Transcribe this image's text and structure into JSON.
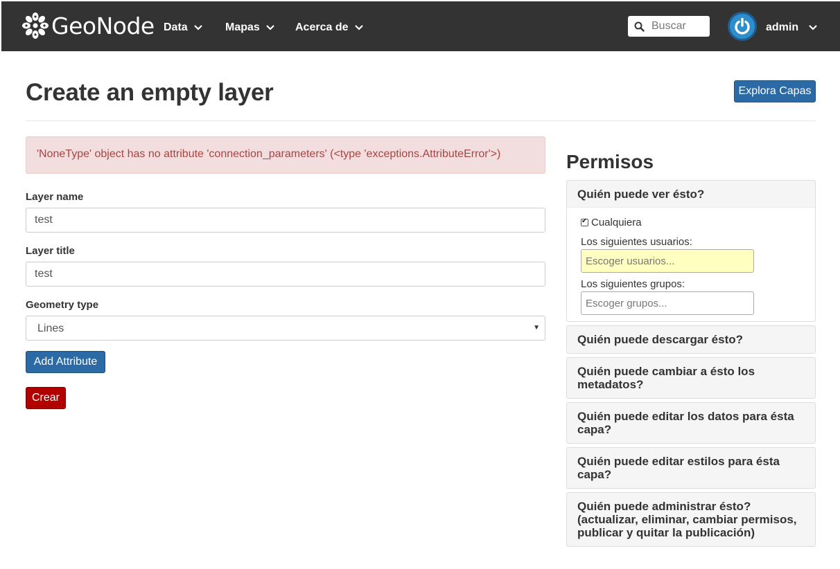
{
  "nav": {
    "brand": "GeoNode",
    "menu": [
      {
        "label": "Data"
      },
      {
        "label": "Mapas"
      },
      {
        "label": "Acerca de"
      }
    ],
    "search_placeholder": "Buscar",
    "user": "admin"
  },
  "page": {
    "title": "Create an empty layer",
    "explore_button": "Explora Capas"
  },
  "alert": {
    "message": "'NoneType' object has no attribute 'connection_parameters' (<type 'exceptions.AttributeError'>)"
  },
  "form": {
    "layer_name_label": "Layer name",
    "layer_name_value": "test",
    "layer_title_label": "Layer title",
    "layer_title_value": "test",
    "geometry_label": "Geometry type",
    "geometry_value": "Lines",
    "add_attribute": "Add Attribute",
    "create": "Crear"
  },
  "permissions": {
    "title": "Permisos",
    "view": {
      "heading": "Quién puede ver ésto?",
      "anyone_label": "Cualquiera",
      "anyone_checked": true,
      "users_label": "Los siguientes usuarios:",
      "users_placeholder": "Escoger usuarios...",
      "groups_label": "Los siguientes grupos:",
      "groups_placeholder": "Escoger grupos..."
    },
    "panels": [
      {
        "heading": "Quién puede descargar ésto?"
      },
      {
        "heading": "Quién puede cambiar a ésto los metadatos?"
      },
      {
        "heading": "Quién puede editar los datos para ésta capa?"
      },
      {
        "heading": "Quién puede editar estilos para ésta capa?"
      },
      {
        "heading": "Quién puede administrar ésto? (actualizar, eliminar, cambiar permisos, publicar y quitar la publicación)"
      }
    ]
  },
  "colors": {
    "navbar": "#333333",
    "primary": "#2b6aa4",
    "danger": "#b20000",
    "alert_bg": "#f2dede",
    "alert_text": "#a94442"
  }
}
